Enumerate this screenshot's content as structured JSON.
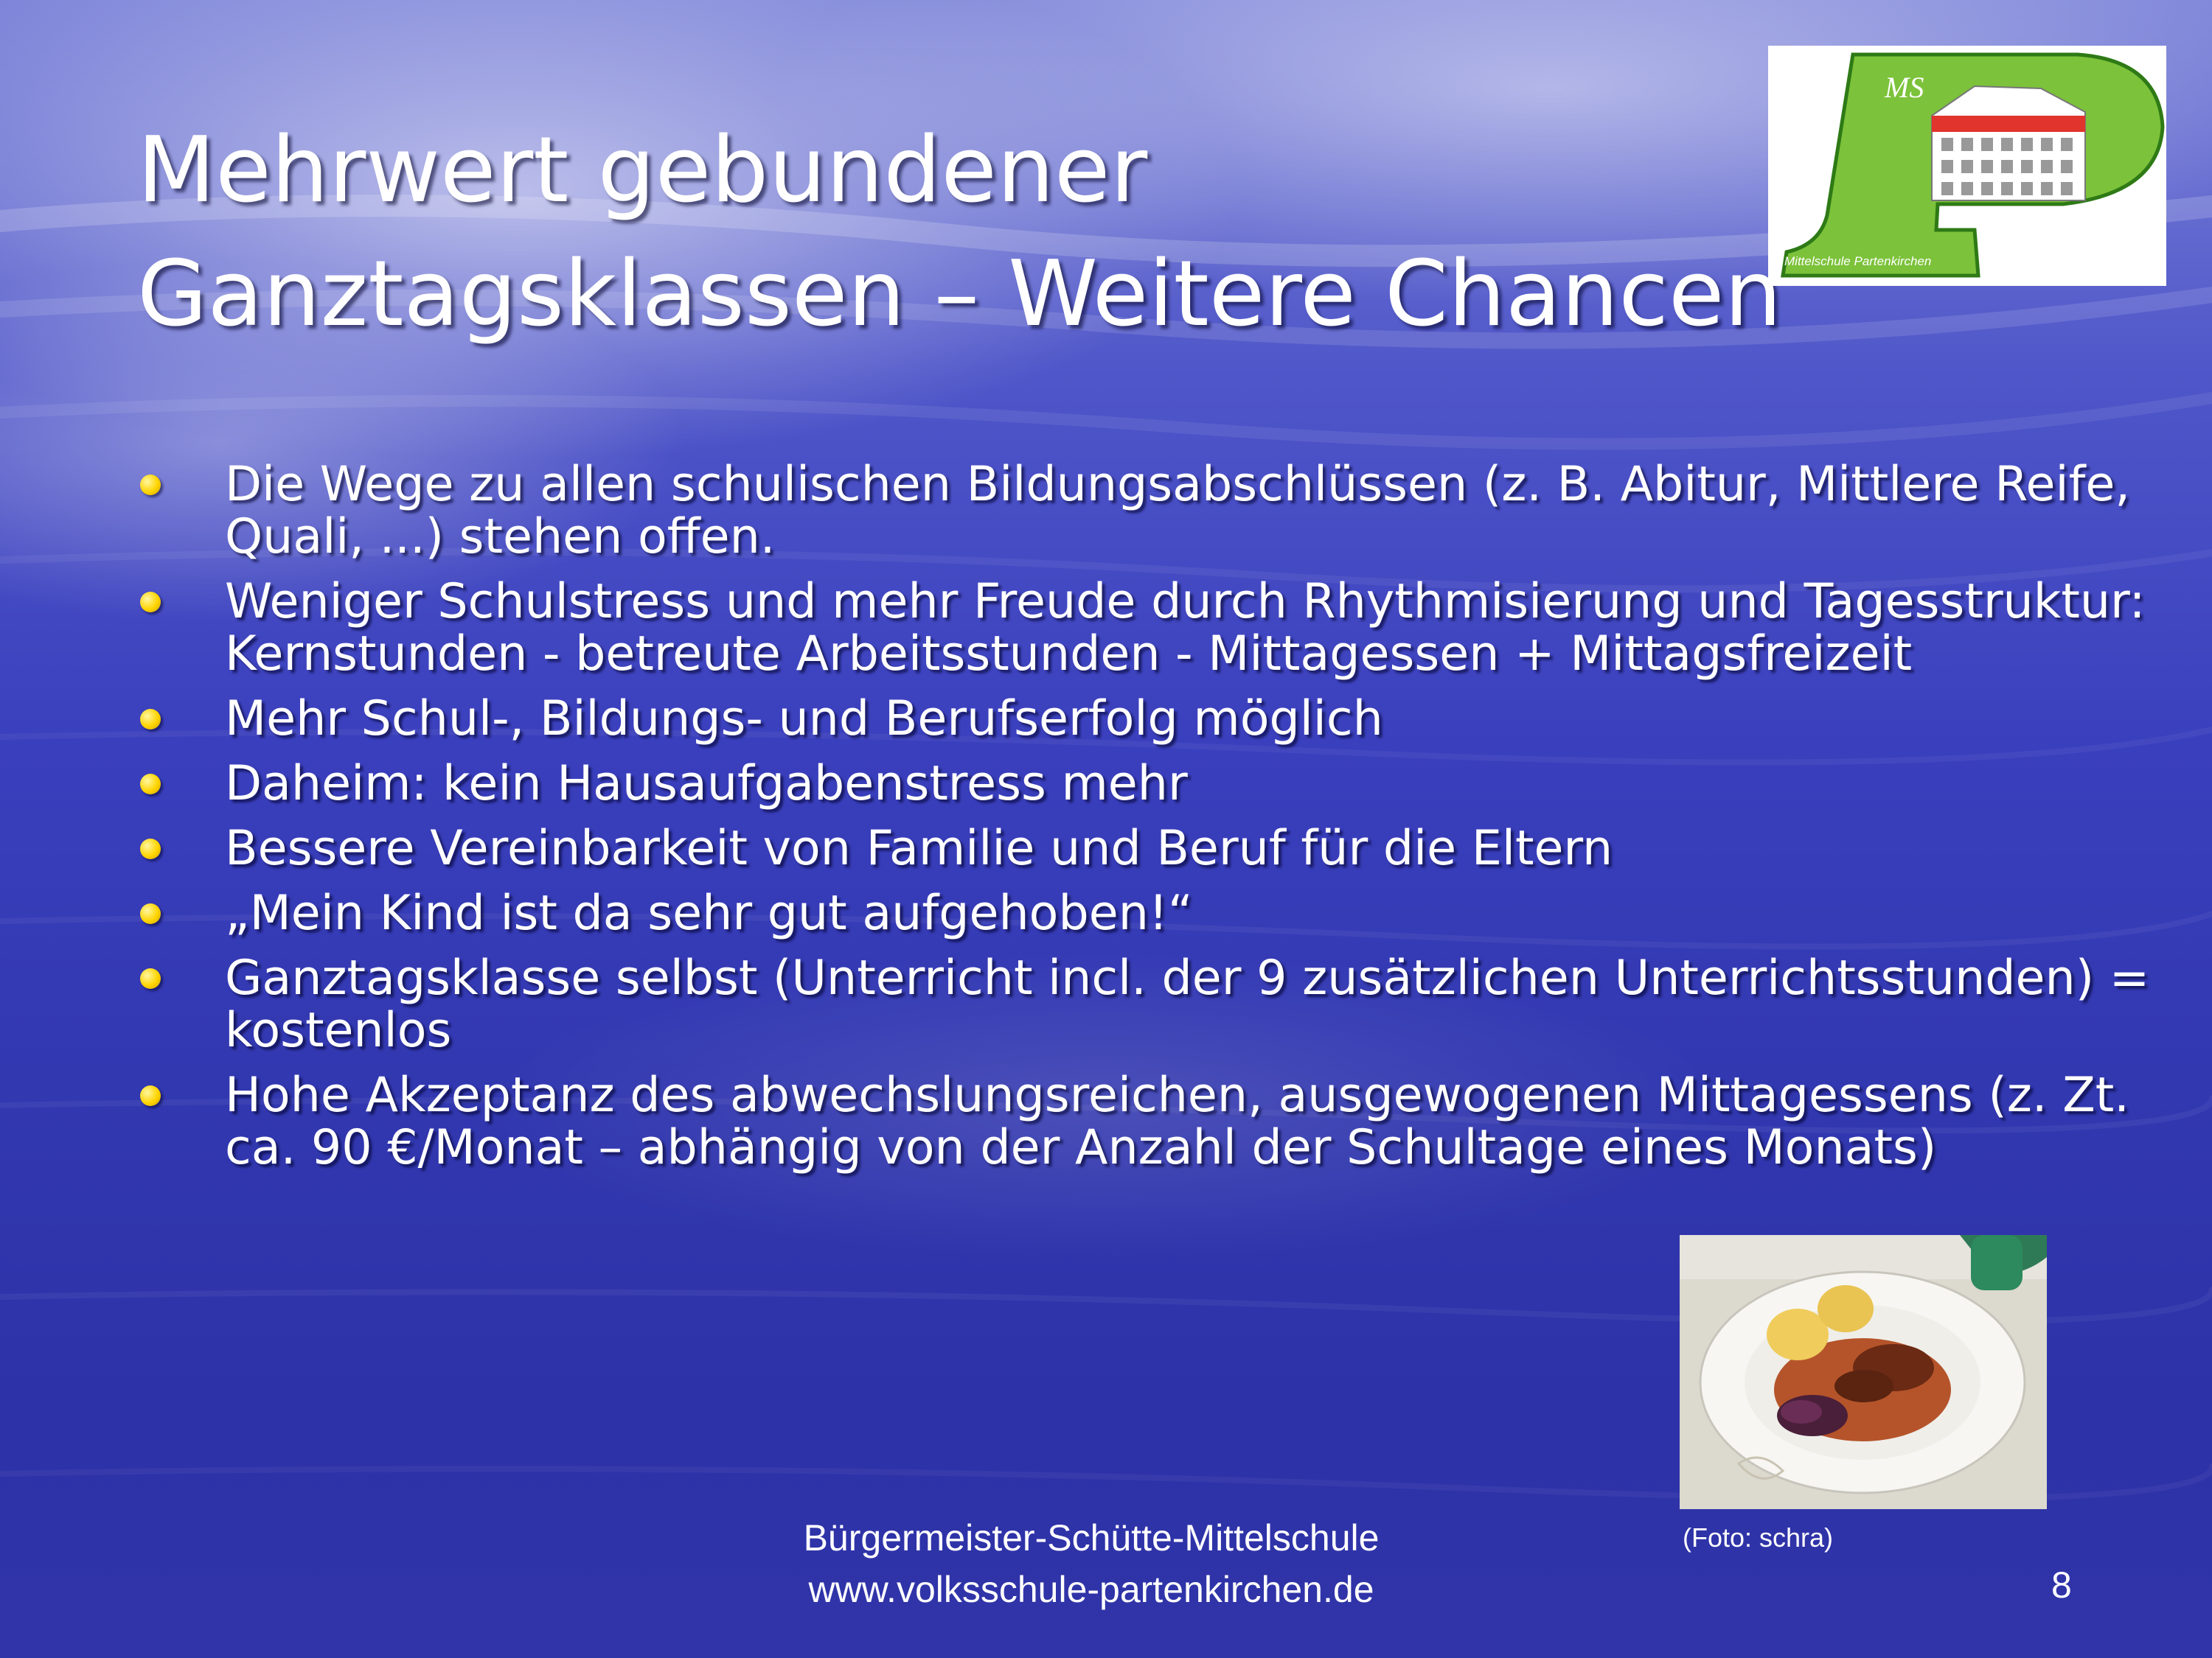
{
  "slide": {
    "title_lines": [
      "Mehrwert gebundener",
      "Ganztagsklassen – Weitere Chancen"
    ],
    "bullets": [
      "Die Wege zu allen schulischen Bildungsabschlüssen (z. B. Abitur, Mittlere Reife, Quali, ...) stehen offen.",
      "Weniger Schulstress und mehr Freude durch Rhythmisierung und Tagesstruktur: Kernstunden - betreute Arbeitsstunden - Mittagessen + Mittagsfreizeit",
      "Mehr Schul-, Bildungs- und Berufserfolg möglich",
      "Daheim: kein Hausaufgabenstress mehr",
      "Bessere Vereinbarkeit von Familie und Beruf für die Eltern",
      "„Mein Kind ist da sehr gut aufgehoben!“",
      "Ganztagsklasse selbst (Unterricht incl. der 9 zusätzlichen Unterrichtsstunden) = kostenlos",
      "Hohe Akzeptanz des abwechslungsreichen, ausgewogenen Mittagessens (z. Zt. ca. 90 €/Monat – abhängig von der Anzahl der Schultage eines Monats)"
    ],
    "logo": {
      "letters": "MS",
      "school_name": "Mittelschule Partenkirchen"
    },
    "photo_caption": "(Foto: schra)",
    "footer_lines": [
      "Bürgermeister-Schütte-Mittelschule",
      "www.volksschule-partenkirchen.de"
    ],
    "page_number": "8"
  },
  "colors": {
    "background_top": "#7f86d9",
    "background_bottom": "#3034a8",
    "text": "#ffffff",
    "bullet": "#ffd400",
    "logo_green": "#7cc23a"
  }
}
